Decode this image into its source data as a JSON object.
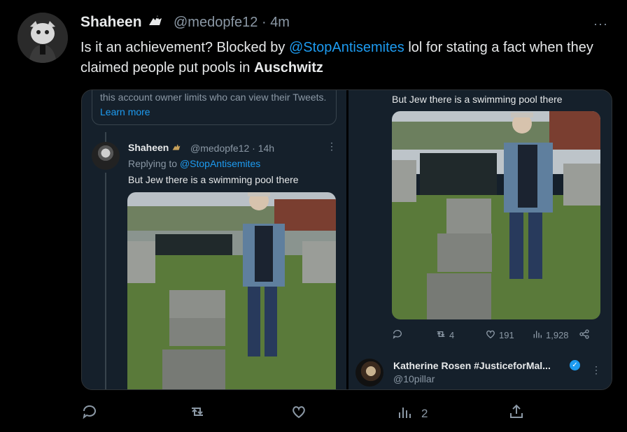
{
  "tweet": {
    "author_name": "Shaheen",
    "author_handle": "@medopfe12",
    "separator": "·",
    "time": "4m",
    "text_before": "Is it an achievement? Blocked by ",
    "mention": "@StopAntisemites",
    "text_middle": " lol for stating a fact when they claimed people put pools in ",
    "text_bold": "Auschwitz",
    "more_label": "···",
    "actions": {
      "views_count": "2"
    }
  },
  "media_left": {
    "restriction_text": "this account owner limits who can view their Tweets.",
    "learn_more": "Learn more",
    "reply": {
      "author_name": "Shaheen",
      "author_handle": "@medopfe12 · 14h",
      "replying_to_prefix": "Replying to ",
      "replying_to_handle": "@StopAntisemites",
      "text": "But Jew there is a swimming pool there",
      "more_label": "⋮"
    }
  },
  "media_right": {
    "text": "But Jew there is a swimming pool there",
    "actions": {
      "retweets": "4",
      "likes": "191",
      "views": "1,928"
    },
    "next_reply": {
      "author_name": "Katherine Rosen #JusticeforMal...",
      "author_handle": "@10pillar",
      "verified_mark": "✓",
      "more_label": "⋮"
    }
  },
  "colors": {
    "background": "#000000",
    "accent": "#1d9bf0",
    "secondary_text": "#8b98a5",
    "dim_panel": "#15202b"
  }
}
